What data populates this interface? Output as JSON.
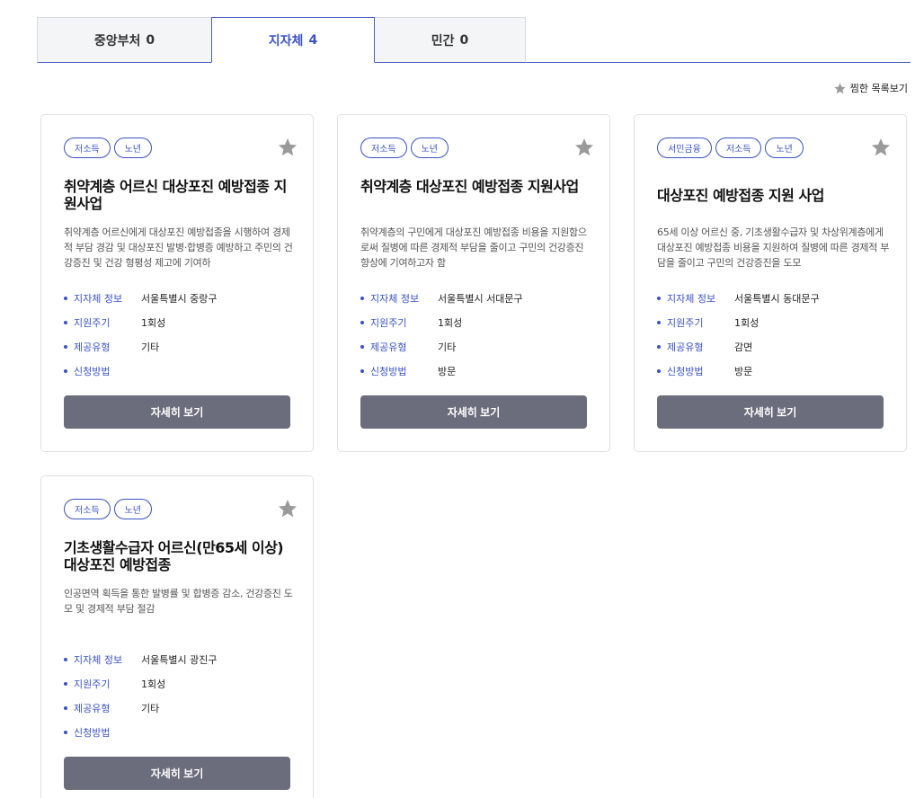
{
  "tabs": [
    {
      "label": "중앙부처",
      "count": "0"
    },
    {
      "label": "지자체",
      "count": "4"
    },
    {
      "label": "민간",
      "count": "0"
    }
  ],
  "favorites_link": "찜한 목록보기",
  "labels": {
    "region": "지자체 정보",
    "cycle": "지원주기",
    "type": "제공유형",
    "apply": "신청방법",
    "detail_button": "자세히 보기"
  },
  "colors": {
    "accent": "#3a52c4",
    "button": "#6b6d7c",
    "star": "#9a9a9a"
  },
  "cards": [
    {
      "tags": [
        "저소득",
        "노년"
      ],
      "title": "취약계층 어르신 대상포진 예방접종 지원사업",
      "desc": "취약계층 어르신에게 대상포진 예방접종을 시행하여 경제적 부담 경감 및 대상포진 발병·합병증 예방하고 주민의 건강증진 및 건강 형평성 제고에 기여하",
      "region": "서울특별시 중랑구",
      "cycle": "1회성",
      "type": "기타",
      "apply": ""
    },
    {
      "tags": [
        "저소득",
        "노년"
      ],
      "title": "취약계층 대상포진 예방접종 지원사업",
      "desc": "취약계층의 구민에게 대상포진 예방접종 비용을 지원함으로써 질병에 따른 경제적 부담을 줄이고 구민의 건강증진 향상에 기여하고자 함",
      "region": "서울특별시 서대문구",
      "cycle": "1회성",
      "type": "기타",
      "apply": "방문"
    },
    {
      "tags": [
        "서민금융",
        "저소득",
        "노년"
      ],
      "title": "대상포진 예방접종 지원 사업",
      "desc": "65세 이상 어르신 중, 기초생활수급자 및 차상위계층에게 대상포진 예방접종 비용을 지원하여 질병에 따른 경제적 부담을 줄이고 구민의 건강증진을 도모",
      "region": "서울특별시 동대문구",
      "cycle": "1회성",
      "type": "감면",
      "apply": "방문"
    },
    {
      "tags": [
        "저소득",
        "노년"
      ],
      "title": "기초생활수급자  어르신(만65세  이상) 대상포진 예방접종",
      "desc": "인공면역 획득을 통한 발병률 및 합병증 감소, 건강증진 도모 및 경제적 부담 절감",
      "region": "서울특별시 광진구",
      "cycle": "1회성",
      "type": "기타",
      "apply": ""
    }
  ]
}
